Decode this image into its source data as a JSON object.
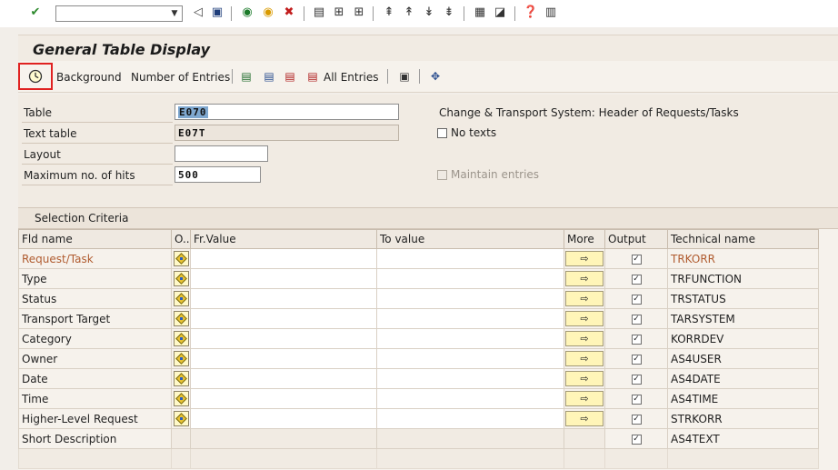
{
  "title": "General Table Display",
  "system_toolbar": {
    "command_field_value": "",
    "icons": [
      "enter-icon",
      "back-icon",
      "save-icon",
      "back-green-icon",
      "exit-icon",
      "cancel-icon",
      "print-icon",
      "find-icon",
      "find-next-icon",
      "first-page-icon",
      "previous-page-icon",
      "next-page-icon",
      "last-page-icon",
      "create-session-icon",
      "shortcut-icon",
      "help-icon",
      "layout-menu-icon"
    ]
  },
  "app_toolbar": {
    "execute_label": "",
    "background_label": "Background",
    "number_of_entries_label": "Number of Entries",
    "all_entries_label": "All Entries"
  },
  "form": {
    "table_label": "Table",
    "table_value": "E070",
    "text_table_label": "Text table",
    "text_table_value": "E07T",
    "layout_label": "Layout",
    "layout_value": "",
    "max_hits_label": "Maximum no. of hits",
    "max_hits_value": "500",
    "table_description": "Change & Transport System: Header of Requests/Tasks",
    "no_texts_label": "No texts",
    "maintain_entries_label": "Maintain entries"
  },
  "criteria": {
    "section_title": "Selection Criteria",
    "columns": [
      "Fld name",
      "O..",
      "Fr.Value",
      "To value",
      "More",
      "Output",
      "Technical name"
    ],
    "rows": [
      {
        "name": "Request/Task",
        "tech": "TRKORR"
      },
      {
        "name": "Type",
        "tech": "TRFUNCTION"
      },
      {
        "name": "Status",
        "tech": "TRSTATUS"
      },
      {
        "name": "Transport Target",
        "tech": "TARSYSTEM"
      },
      {
        "name": "Category",
        "tech": "KORRDEV"
      },
      {
        "name": "Owner",
        "tech": "AS4USER"
      },
      {
        "name": "Date",
        "tech": "AS4DATE"
      },
      {
        "name": "Time",
        "tech": "AS4TIME"
      },
      {
        "name": "Higher-Level Request",
        "tech": "STRKORR"
      },
      {
        "name": "Short Description",
        "tech": "AS4TEXT"
      }
    ],
    "output_checked_symbol": "✓",
    "more_symbol": "⇨"
  },
  "colors": {
    "highlight_red": "#e02121",
    "key_field_text": "#b05c30",
    "panel_bg": "#f1ebe3"
  }
}
